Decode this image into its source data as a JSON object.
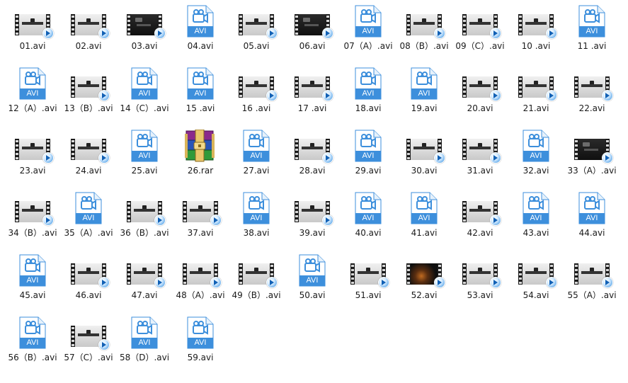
{
  "files": [
    {
      "name": "01.avi",
      "icon": "video-thumbnail-icon",
      "variant": "light"
    },
    {
      "name": "02.avi",
      "icon": "video-thumbnail-icon",
      "variant": "light"
    },
    {
      "name": "03.avi",
      "icon": "video-thumbnail-icon",
      "variant": "dark"
    },
    {
      "name": "04.avi",
      "icon": "avi-file-icon",
      "label": "AVI"
    },
    {
      "name": "05.avi",
      "icon": "video-thumbnail-icon",
      "variant": "light"
    },
    {
      "name": "06.avi",
      "icon": "video-thumbnail-icon",
      "variant": "dark"
    },
    {
      "name": "07（A）.avi",
      "icon": "avi-file-icon",
      "label": "AVI"
    },
    {
      "name": "08（B）.avi",
      "icon": "video-thumbnail-icon",
      "variant": "light"
    },
    {
      "name": "09（C）.avi",
      "icon": "video-thumbnail-icon",
      "variant": "light"
    },
    {
      "name": "10 .avi",
      "icon": "video-thumbnail-icon",
      "variant": "light"
    },
    {
      "name": "11 .avi",
      "icon": "avi-file-icon",
      "label": "AVI"
    },
    {
      "name": "12（A）.avi",
      "icon": "avi-file-icon",
      "label": "AVI"
    },
    {
      "name": "13（B）.avi",
      "icon": "video-thumbnail-icon",
      "variant": "light"
    },
    {
      "name": "14（C）.avi",
      "icon": "avi-file-icon",
      "label": "AVI"
    },
    {
      "name": "15 .avi",
      "icon": "avi-file-icon",
      "label": "AVI"
    },
    {
      "name": "16 .avi",
      "icon": "video-thumbnail-icon",
      "variant": "light"
    },
    {
      "name": "17 .avi",
      "icon": "video-thumbnail-icon",
      "variant": "light"
    },
    {
      "name": "18.avi",
      "icon": "avi-file-icon",
      "label": "AVI"
    },
    {
      "name": "19.avi",
      "icon": "avi-file-icon",
      "label": "AVI"
    },
    {
      "name": "20.avi",
      "icon": "video-thumbnail-icon",
      "variant": "light"
    },
    {
      "name": "21.avi",
      "icon": "video-thumbnail-icon",
      "variant": "light"
    },
    {
      "name": "22.avi",
      "icon": "video-thumbnail-icon",
      "variant": "light"
    },
    {
      "name": "23.avi",
      "icon": "video-thumbnail-icon",
      "variant": "light"
    },
    {
      "name": "24.avi",
      "icon": "video-thumbnail-icon",
      "variant": "light"
    },
    {
      "name": "25.avi",
      "icon": "avi-file-icon",
      "label": "AVI"
    },
    {
      "name": "26.rar",
      "icon": "rar-archive-icon"
    },
    {
      "name": "27.avi",
      "icon": "avi-file-icon",
      "label": "AVI"
    },
    {
      "name": "28.avi",
      "icon": "video-thumbnail-icon",
      "variant": "light"
    },
    {
      "name": "29.avi",
      "icon": "avi-file-icon",
      "label": "AVI"
    },
    {
      "name": "30.avi",
      "icon": "video-thumbnail-icon",
      "variant": "light"
    },
    {
      "name": "31.avi",
      "icon": "video-thumbnail-icon",
      "variant": "light"
    },
    {
      "name": "32.avi",
      "icon": "avi-file-icon",
      "label": "AVI"
    },
    {
      "name": "33（A）.avi",
      "icon": "video-thumbnail-icon",
      "variant": "dark"
    },
    {
      "name": "34（B）.avi",
      "icon": "video-thumbnail-icon",
      "variant": "light"
    },
    {
      "name": "35（A）.avi",
      "icon": "avi-file-icon",
      "label": "AVI"
    },
    {
      "name": "36（B）.avi",
      "icon": "video-thumbnail-icon",
      "variant": "light"
    },
    {
      "name": "37.avi",
      "icon": "video-thumbnail-icon",
      "variant": "light"
    },
    {
      "name": "38.avi",
      "icon": "avi-file-icon",
      "label": "AVI"
    },
    {
      "name": "39.avi",
      "icon": "video-thumbnail-icon",
      "variant": "light"
    },
    {
      "name": "40.avi",
      "icon": "avi-file-icon",
      "label": "AVI"
    },
    {
      "name": "41.avi",
      "icon": "avi-file-icon",
      "label": "AVI"
    },
    {
      "name": "42.avi",
      "icon": "video-thumbnail-icon",
      "variant": "light"
    },
    {
      "name": "43.avi",
      "icon": "avi-file-icon",
      "label": "AVI"
    },
    {
      "name": "44.avi",
      "icon": "avi-file-icon",
      "label": "AVI"
    },
    {
      "name": "45.avi",
      "icon": "avi-file-icon",
      "label": "AVI"
    },
    {
      "name": "46.avi",
      "icon": "video-thumbnail-icon",
      "variant": "light"
    },
    {
      "name": "47.avi",
      "icon": "video-thumbnail-icon",
      "variant": "light"
    },
    {
      "name": "48（A）.avi",
      "icon": "video-thumbnail-icon",
      "variant": "light"
    },
    {
      "name": "49（B）.avi",
      "icon": "video-thumbnail-icon",
      "variant": "light"
    },
    {
      "name": "50.avi",
      "icon": "avi-file-icon",
      "label": "AVI"
    },
    {
      "name": "51.avi",
      "icon": "video-thumbnail-icon",
      "variant": "light"
    },
    {
      "name": "52.avi",
      "icon": "video-thumbnail-icon",
      "variant": "photo"
    },
    {
      "name": "53.avi",
      "icon": "video-thumbnail-icon",
      "variant": "light"
    },
    {
      "name": "54.avi",
      "icon": "video-thumbnail-icon",
      "variant": "light"
    },
    {
      "name": "55（A）.avi",
      "icon": "video-thumbnail-icon",
      "variant": "light"
    },
    {
      "name": "56（B）.avi",
      "icon": "avi-file-icon",
      "label": "AVI"
    },
    {
      "name": "57（C）.avi",
      "icon": "video-thumbnail-icon",
      "variant": "light"
    },
    {
      "name": "58（D）.avi",
      "icon": "avi-file-icon",
      "label": "AVI"
    },
    {
      "name": "59.avi",
      "icon": "avi-file-icon",
      "label": "AVI"
    }
  ],
  "colors": {
    "avi_accent": "#3d8fdc",
    "avi_page": "#ffffff",
    "avi_border": "#3d8fdc",
    "text": "#1a1a1a"
  }
}
